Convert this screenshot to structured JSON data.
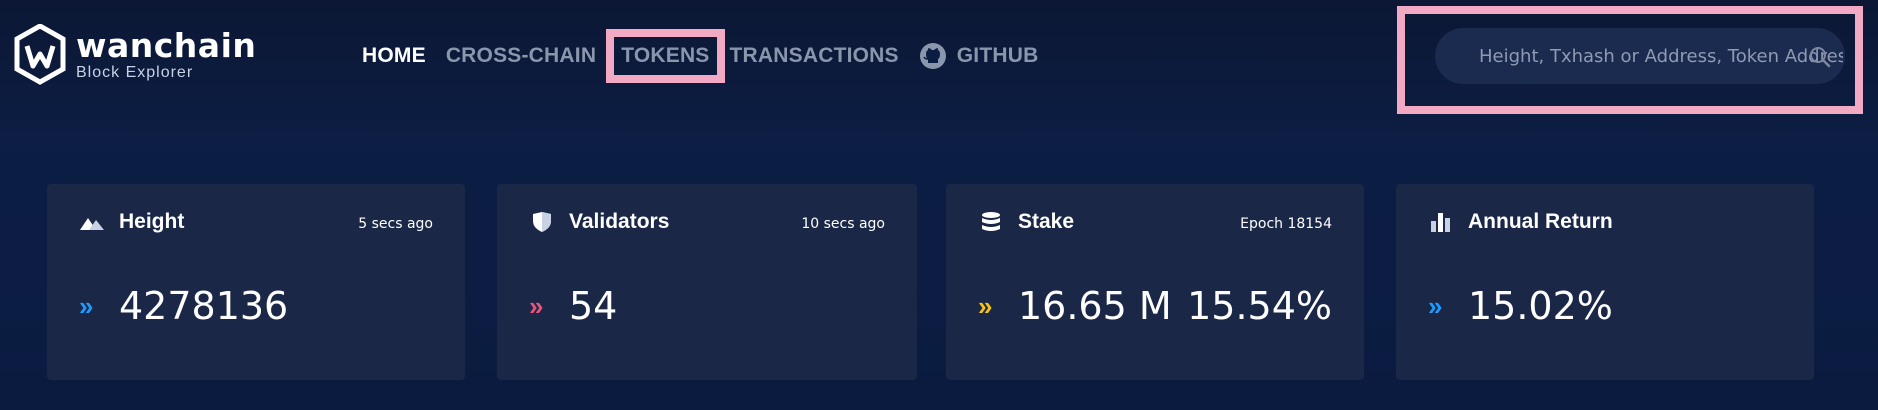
{
  "brand": {
    "name": "wanchain",
    "subtitle": "Block Explorer"
  },
  "nav": {
    "home": "HOME",
    "cross_chain": "CROSS-CHAIN",
    "tokens": "TOKENS",
    "transactions": "TRANSACTIONS",
    "github": "GITHUB"
  },
  "search": {
    "placeholder": "Height, Txhash or Address, Token Address"
  },
  "cards": {
    "height": {
      "title": "Height",
      "meta": "5 secs ago",
      "value": "4278136",
      "chevron_color": "#1e9bff"
    },
    "validators": {
      "title": "Validators",
      "meta": "10 secs ago",
      "value": "54",
      "chevron_color": "#e8557b"
    },
    "stake": {
      "title": "Stake",
      "meta": "Epoch 18154",
      "value": "16.65 M",
      "value2": "15.54%",
      "chevron_color": "#f3c21a"
    },
    "annual_return": {
      "title": "Annual Return",
      "value": "15.02%",
      "chevron_color": "#1e9bff"
    }
  },
  "colors": {
    "highlight": "#f2a9c4",
    "card_bg": "#1a2747",
    "page_bg": "#0c1d44"
  },
  "icons": [
    "wanchain-logo-icon",
    "github-icon",
    "search-icon",
    "mountain-icon",
    "shield-icon",
    "database-icon",
    "bar-chart-icon",
    "double-chevron-icon"
  ]
}
